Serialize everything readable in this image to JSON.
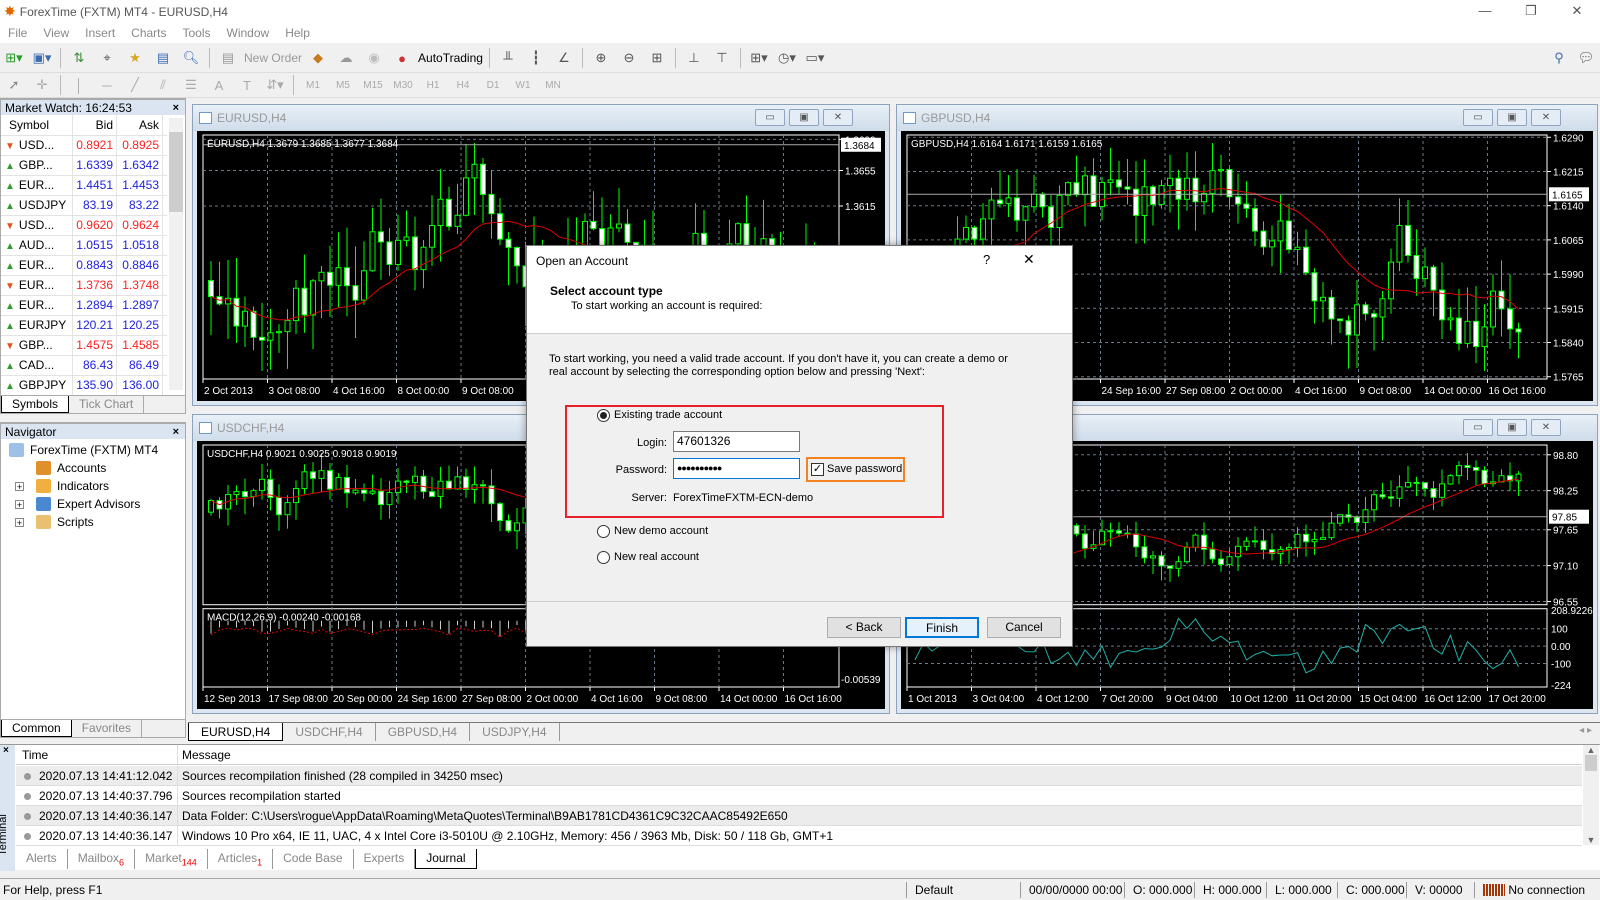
{
  "window": {
    "title": "ForexTime (FXTM) MT4 - EURUSD,H4",
    "minimize": "—",
    "maximize": "❐",
    "close": "✕"
  },
  "menu": [
    "File",
    "View",
    "Insert",
    "Charts",
    "Tools",
    "Window",
    "Help"
  ],
  "toolbar": {
    "new_order": "New Order",
    "autotrading": "AutoTrading",
    "timeframes": [
      "M1",
      "M5",
      "M15",
      "M30",
      "H1",
      "H4",
      "D1",
      "W1",
      "MN"
    ]
  },
  "market_watch": {
    "title": "Market Watch: 16:24:53",
    "columns": [
      "Symbol",
      "Bid",
      "Ask"
    ],
    "colors": {
      "up": "#2020e0",
      "down": "#ff2020"
    },
    "rows": [
      {
        "symbol": "USD...",
        "bid": "0.8921",
        "ask": "0.8925",
        "dir": "down"
      },
      {
        "symbol": "GBP...",
        "bid": "1.6339",
        "ask": "1.6342",
        "dir": "up"
      },
      {
        "symbol": "EUR...",
        "bid": "1.4451",
        "ask": "1.4453",
        "dir": "up"
      },
      {
        "symbol": "USDJPY",
        "bid": "83.19",
        "ask": "83.22",
        "dir": "up"
      },
      {
        "symbol": "USD...",
        "bid": "0.9620",
        "ask": "0.9624",
        "dir": "down"
      },
      {
        "symbol": "AUD...",
        "bid": "1.0515",
        "ask": "1.0518",
        "dir": "up"
      },
      {
        "symbol": "EUR...",
        "bid": "0.8843",
        "ask": "0.8846",
        "dir": "up"
      },
      {
        "symbol": "EUR...",
        "bid": "1.3736",
        "ask": "1.3748",
        "dir": "down"
      },
      {
        "symbol": "EUR...",
        "bid": "1.2894",
        "ask": "1.2897",
        "dir": "up"
      },
      {
        "symbol": "EURJPY",
        "bid": "120.21",
        "ask": "120.25",
        "dir": "up"
      },
      {
        "symbol": "GBP...",
        "bid": "1.4575",
        "ask": "1.4585",
        "dir": "down"
      },
      {
        "symbol": "CAD...",
        "bid": "86.43",
        "ask": "86.49",
        "dir": "up"
      },
      {
        "symbol": "GBPJPY",
        "bid": "135.90",
        "ask": "136.00",
        "dir": "up"
      }
    ],
    "tabs": [
      "Symbols",
      "Tick Chart"
    ]
  },
  "navigator": {
    "title": "Navigator",
    "root": "ForexTime (FXTM) MT4",
    "items": [
      {
        "label": "Accounts",
        "icon": "accounts-icon"
      },
      {
        "label": "Indicators",
        "icon": "indicators-icon"
      },
      {
        "label": "Expert Advisors",
        "icon": "expert-advisors-icon"
      },
      {
        "label": "Scripts",
        "icon": "scripts-icon"
      }
    ],
    "tabs": [
      "Common",
      "Favorites"
    ]
  },
  "charts": [
    {
      "title": "EURUSD,H4",
      "info": "EURUSD,H4  1.3679 1.3685 1.3677 1.3684",
      "price_labels": [
        "1.3690",
        "1.3655",
        "1.3615"
      ],
      "current": "1.3684",
      "time_labels": [
        "2 Oct 2013",
        "3 Oct 08:00",
        "4 Oct 16:00",
        "8 Oct 00:00",
        "9 Oct 08:00"
      ]
    },
    {
      "title": "GBPUSD,H4",
      "info": "GBPUSD,H4  1.6164 1.6171 1.6159 1.6165",
      "price_labels": [
        "1.6290",
        "1.6215",
        "1.6140",
        "1.6065",
        "1.5990",
        "1.5915",
        "1.5840",
        "1.5765"
      ],
      "current": "1.6165",
      "time_labels": [
        "24 Sep 16:00",
        "27 Sep 08:00",
        "2 Oct 00:00",
        "4 Oct 16:00",
        "9 Oct 08:00",
        "14 Oct 00:00",
        "16 Oct 16:00"
      ]
    },
    {
      "title": "USDCHF,H4",
      "info": "USDCHF,H4  0.9021 0.9025 0.9018 0.9019",
      "price_labels": [],
      "current": "",
      "indicator": {
        "info": "MACD(12,26,9) -0.00240 -0.00168",
        "labels": [
          "-0.00539"
        ]
      },
      "time_labels": [
        "12 Sep 2013",
        "17 Sep 08:00",
        "20 Sep 00:00",
        "24 Sep 16:00",
        "27 Sep 08:00",
        "2 Oct 00:00",
        "4 Oct 16:00",
        "9 Oct 08:00",
        "14 Oct 00:00",
        "16 Oct 16:00"
      ]
    },
    {
      "title": "USDJPY,H4",
      "info": "",
      "price_labels": [
        "98.80",
        "98.25",
        "97.65",
        "97.10",
        "96.55"
      ],
      "current": "97.85",
      "indicator": {
        "info": "",
        "labels": [
          "208.9226",
          "100",
          "0.00",
          "-100",
          "-224"
        ]
      },
      "time_labels": [
        "1 Oct 2013",
        "3 Oct 04:00",
        "4 Oct 12:00",
        "7 Oct 20:00",
        "9 Oct 04:00",
        "10 Oct 12:00",
        "11 Oct 20:00",
        "15 Oct 04:00",
        "16 Oct 12:00",
        "17 Oct 20:00"
      ]
    }
  ],
  "chart_tabs": [
    "EURUSD,H4",
    "USDCHF,H4",
    "GBPUSD,H4",
    "USDJPY,H4"
  ],
  "terminal": {
    "side_label": "Terminal",
    "columns": [
      "Time",
      "Message"
    ],
    "rows": [
      {
        "time": "2020.07.13 14:41:12.042",
        "message": "Sources recompilation finished (28 compiled in 34250 msec)"
      },
      {
        "time": "2020.07.13 14:40:37.796",
        "message": "Sources recompilation started"
      },
      {
        "time": "2020.07.13 14:40:36.147",
        "message": "Data Folder: C:\\Users\\rogue\\AppData\\Roaming\\MetaQuotes\\Terminal\\B9AB1781CD4361C9C32CAAC85492E650"
      },
      {
        "time": "2020.07.13 14:40:36.147",
        "message": "Windows 10 Pro x64, IE 11, UAC, 4 x Intel Core i3-5010U  @ 2.10GHz, Memory: 456 / 3963 Mb, Disk: 50 / 118 Gb, GMT+1"
      }
    ],
    "tabs": [
      {
        "label": "Alerts",
        "badge": ""
      },
      {
        "label": "Mailbox",
        "badge": "6"
      },
      {
        "label": "Market",
        "badge": "144"
      },
      {
        "label": "Articles",
        "badge": "1"
      },
      {
        "label": "Code Base",
        "badge": ""
      },
      {
        "label": "Experts",
        "badge": ""
      },
      {
        "label": "Journal",
        "badge": ""
      }
    ]
  },
  "status": {
    "help": "For Help, press F1",
    "profile": "Default",
    "datetime": "00/00/0000 00:00",
    "open": "O: 000.000",
    "high": "H: 000.000",
    "low": "L: 000.000",
    "close": "C: 000.000",
    "volume": "V: 00000",
    "connection": "No connection"
  },
  "dialog": {
    "title": "Open an Account",
    "help": "?",
    "close": "✕",
    "heading": "Select account type",
    "subheading": "To start working an account is required:",
    "description": "To start working, you need a valid trade account. If you don't have it, you can create a demo or real account by selecting the corresponding option below and pressing 'Next':",
    "options": {
      "existing": "Existing trade account",
      "demo": "New demo account",
      "real": "New real account"
    },
    "selected": "existing",
    "login_label": "Login:",
    "login_value": "47601326",
    "password_label": "Password:",
    "password_value": "●●●●●●●●●●",
    "save_password": "Save password",
    "save_password_checked": true,
    "server_label": "Server:",
    "server_value": "ForexTimeFXTM-ECN-demo",
    "buttons": {
      "back": "< Back",
      "finish": "Finish",
      "cancel": "Cancel"
    },
    "highlight_colors": {
      "group": "#e8202a",
      "checkbox": "#f58220"
    }
  }
}
